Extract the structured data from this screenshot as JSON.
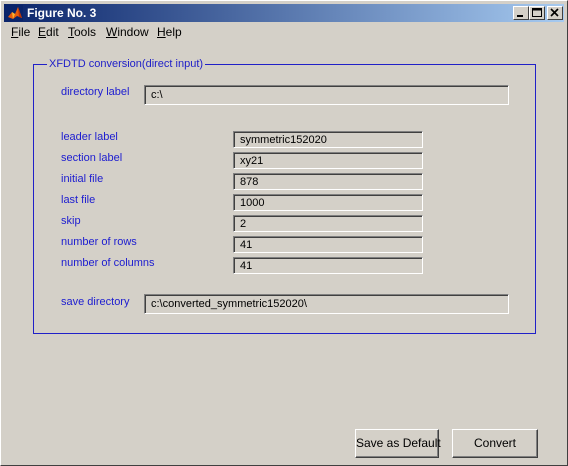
{
  "window": {
    "title": "Figure No. 3",
    "controls": [
      "minimize-icon",
      "maximize-icon",
      "close-icon"
    ]
  },
  "menubar": {
    "items": [
      {
        "label": "File",
        "mnemonic": "F",
        "rest": "ile"
      },
      {
        "label": "Edit",
        "mnemonic": "E",
        "rest": "dit"
      },
      {
        "label": "Tools",
        "mnemonic": "T",
        "rest": "ools"
      },
      {
        "label": "Window",
        "mnemonic": "W",
        "rest": "indow"
      },
      {
        "label": "Help",
        "mnemonic": "H",
        "rest": "elp"
      }
    ]
  },
  "panel": {
    "title": "XFDTD conversion(direct input)",
    "directory": {
      "label": "directory label",
      "value": "c:\\"
    },
    "fields": [
      {
        "label": "leader label",
        "value": "symmetric152020"
      },
      {
        "label": "section label",
        "value": "xy21"
      },
      {
        "label": "initial file",
        "value": "878"
      },
      {
        "label": "last file",
        "value": "1000"
      },
      {
        "label": "skip",
        "value": "2"
      },
      {
        "label": "number of rows",
        "value": "41"
      },
      {
        "label": "number of columns",
        "value": "41"
      }
    ],
    "save_directory": {
      "label": "save directory",
      "value": "c:\\converted_symmetric152020\\"
    }
  },
  "buttons": {
    "save_default": "Save as Default",
    "convert": "Convert"
  },
  "colors": {
    "titlebar_start": "#0a246a",
    "titlebar_end": "#a6caf0",
    "label_blue": "#1c1cd0",
    "panel_border": "#2020c8",
    "face": "#d4d0c8"
  }
}
